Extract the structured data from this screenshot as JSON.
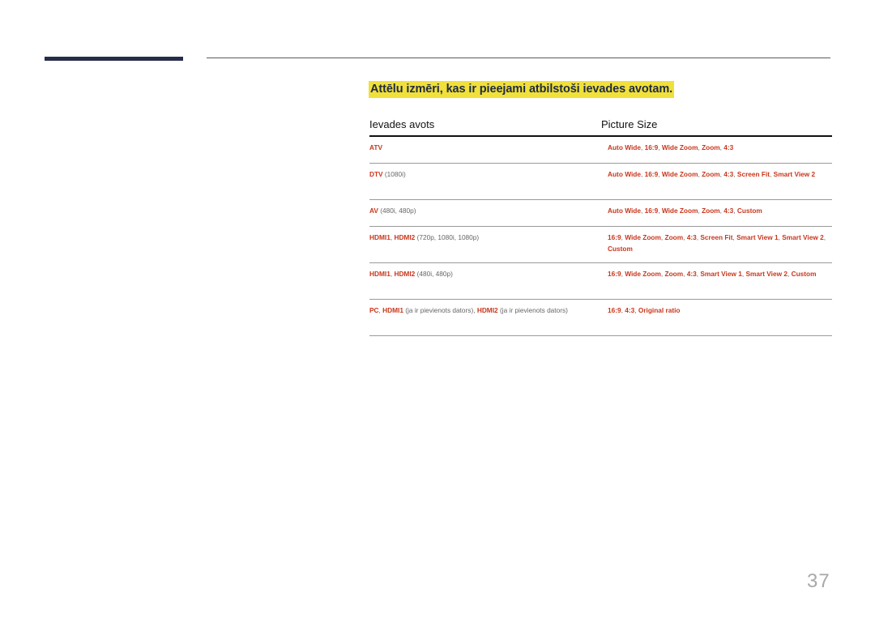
{
  "page": {
    "title": "Attēlu izmēri, kas ir pieejami atbilstoši ievades avotam.",
    "page_number": "37",
    "colors": {
      "accent": "#c8361c",
      "highlight": "#f0e03a",
      "bar": "#252d48"
    }
  },
  "table": {
    "headers": [
      "Ievades avots",
      "Picture Size"
    ],
    "rows": [
      {
        "source": [
          {
            "t": "ATV",
            "r": true
          }
        ],
        "sizes": [
          "Auto Wide",
          "16:9",
          "Wide Zoom",
          "Zoom",
          "4:3"
        ],
        "height": 26
      },
      {
        "source": [
          {
            "t": "DTV",
            "r": true
          },
          {
            "t": " (1080i)",
            "r": false
          }
        ],
        "sizes": [
          "Auto Wide",
          "16:9",
          "Wide Zoom",
          "Zoom",
          "4:3",
          "Screen Fit",
          "Smart View 2"
        ],
        "height": 38
      },
      {
        "source": [
          {
            "t": "AV",
            "r": true
          },
          {
            "t": " (480i, 480p)",
            "r": false
          }
        ],
        "sizes": [
          "Auto Wide",
          "16:9",
          "Wide Zoom",
          "Zoom",
          "4:3",
          "Custom"
        ],
        "height": 26
      },
      {
        "source": [
          {
            "t": "HDMI1",
            "r": true
          },
          {
            "t": ", ",
            "r": false
          },
          {
            "t": "HDMI2",
            "r": true
          },
          {
            "t": " (720p, 1080i, 1080p)",
            "r": false
          }
        ],
        "sizes": [
          "16:9",
          "Wide Zoom",
          "Zoom",
          "4:3",
          "Screen Fit",
          "Smart View 1",
          "Smart View 2",
          "Custom"
        ],
        "height": 38
      },
      {
        "source": [
          {
            "t": "HDMI1",
            "r": true
          },
          {
            "t": ", ",
            "r": false
          },
          {
            "t": "HDMI2",
            "r": true
          },
          {
            "t": " (480i, 480p)",
            "r": false
          }
        ],
        "sizes": [
          "16:9",
          "Wide Zoom",
          "Zoom",
          "4:3",
          "Smart View 1",
          "Smart View 2",
          "Custom"
        ],
        "height": 38
      },
      {
        "source": [
          {
            "t": "PC",
            "r": true
          },
          {
            "t": ", ",
            "r": false
          },
          {
            "t": "HDMI1",
            "r": true
          },
          {
            "t": " (ja ir pievienots dators), ",
            "r": false
          },
          {
            "t": "HDMI2",
            "r": true
          },
          {
            "t": " (ja ir pievienots dators)",
            "r": false
          }
        ],
        "sizes": [
          "16:9",
          "4:3",
          "Original ratio"
        ],
        "height": 38
      }
    ]
  }
}
